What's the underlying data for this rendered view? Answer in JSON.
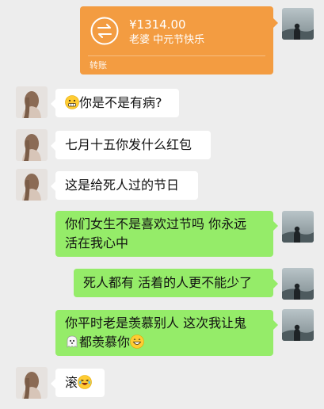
{
  "transfer": {
    "amount": "¥1314.00",
    "note": "老婆 中元节快乐",
    "label": "转账",
    "icon": "transfer-arrows-icon"
  },
  "messages": [
    {
      "side": "left",
      "text": "你是不是有病?",
      "emoji_before": "grimace-emoji"
    },
    {
      "side": "left",
      "text": "七月十五你发什么红包"
    },
    {
      "side": "left",
      "text": "这是给死人过的节日"
    },
    {
      "side": "right",
      "line1": "你们女生不是喜欢过节吗 你永远",
      "line2": "活在我心中"
    },
    {
      "side": "right",
      "text": "死人都有 活着的人更不能少了"
    },
    {
      "side": "right",
      "line1": "你平时老是羡慕别人 这次我让鬼",
      "line2": "都羡慕你",
      "emoji_before": "ghost-emoji",
      "emoji_after": "grin-emoji"
    },
    {
      "side": "left",
      "text": "滚",
      "emoji_after": "laugh-cry-emoji"
    }
  ],
  "colors": {
    "background": "#ededed",
    "bubble_right": "#95ec69",
    "bubble_left": "#ffffff",
    "transfer": "#f39c41"
  }
}
